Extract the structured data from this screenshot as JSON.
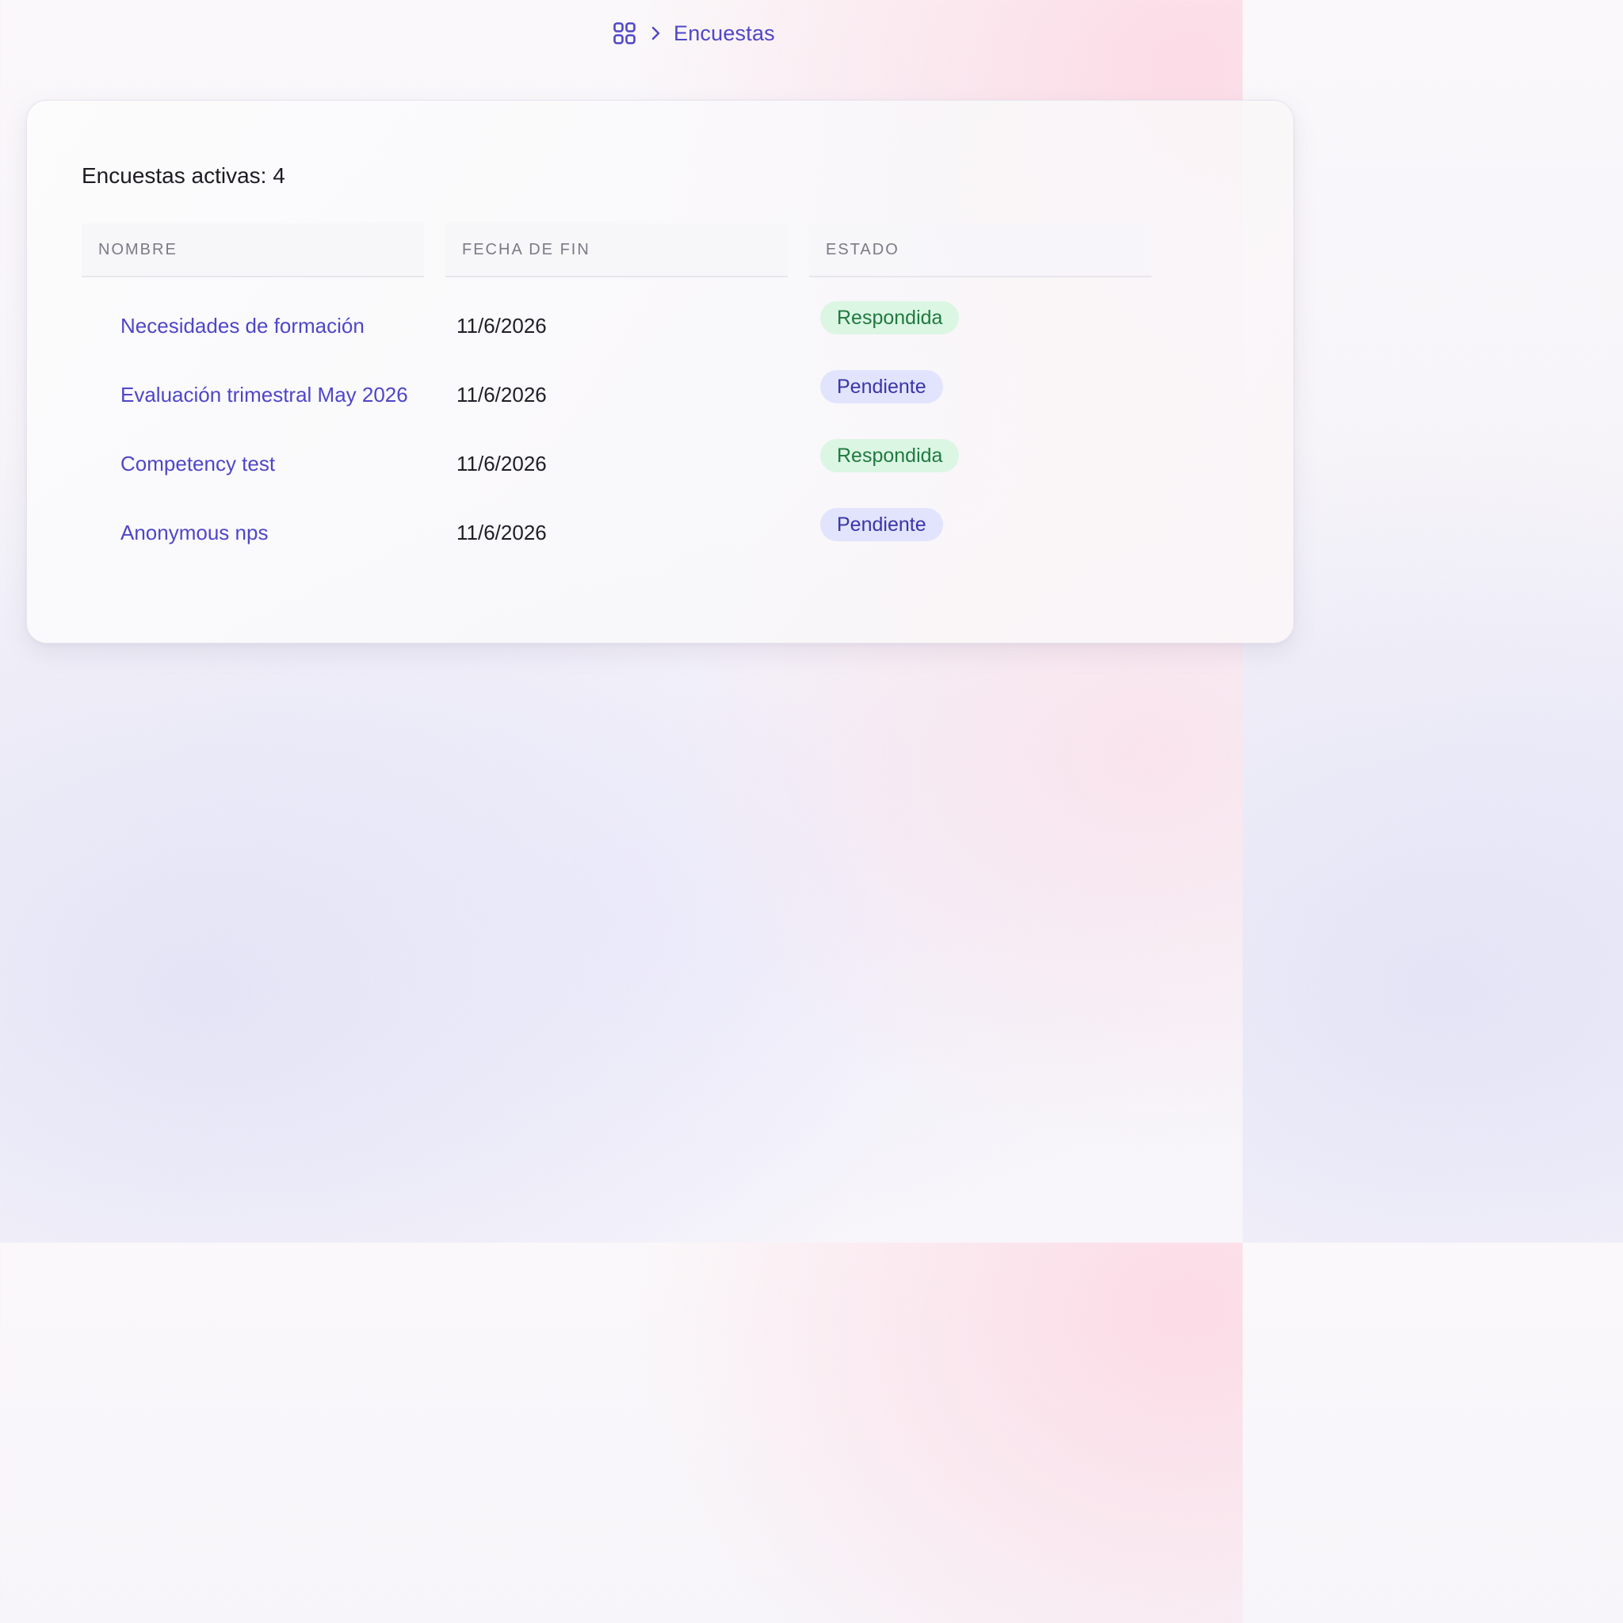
{
  "breadcrumb": {
    "home_icon": "grid-icon",
    "separator_icon": "chevron-right-icon",
    "current": "Encuestas"
  },
  "card": {
    "title": "Encuestas activas: 4"
  },
  "table": {
    "columns": [
      "NOMBRE",
      "FECHA DE FIN",
      "ESTADO"
    ],
    "rows": [
      {
        "name": "Necesidades de formación",
        "end_date": "11/6/2026",
        "status": "Respondida",
        "status_color": "#1f7a3f",
        "status_bg": "#dcf6e4"
      },
      {
        "name": "Evaluación trimestral May 2026",
        "end_date": "11/6/2026",
        "status": "Pendiente",
        "status_color": "#3b35a8",
        "status_bg": "#e1e4fc"
      },
      {
        "name": "Competency test",
        "end_date": "11/6/2026",
        "status": "Respondida",
        "status_color": "#1f7a3f",
        "status_bg": "#dcf6e4"
      },
      {
        "name": "Anonymous nps",
        "end_date": "11/6/2026",
        "status": "Pendiente",
        "status_color": "#3b35a8",
        "status_bg": "#e1e4fc"
      }
    ]
  },
  "colors": {
    "accent": "#4f46c8",
    "text": "#1c1c22",
    "header_text": "#7c7b85"
  }
}
